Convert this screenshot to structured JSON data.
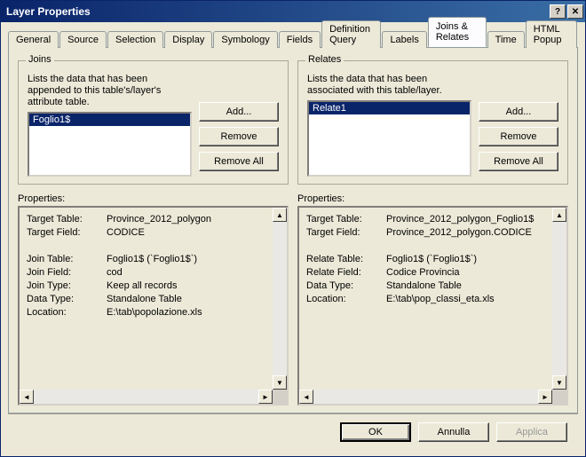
{
  "window": {
    "title": "Layer Properties",
    "help": "?",
    "close": "✕"
  },
  "tabs": [
    "General",
    "Source",
    "Selection",
    "Display",
    "Symbology",
    "Fields",
    "Definition Query",
    "Labels",
    "Joins & Relates",
    "Time",
    "HTML Popup"
  ],
  "active_tab": 8,
  "joins": {
    "legend": "Joins",
    "desc": "Lists the data that has been appended to this table's/layer's attribute table.",
    "items": [
      "Foglio1$"
    ],
    "add": "Add...",
    "remove": "Remove",
    "remove_all": "Remove All"
  },
  "relates": {
    "legend": "Relates",
    "desc": "Lists the data that has been associated with this table/layer.",
    "items": [
      "Relate1"
    ],
    "add": "Add...",
    "remove": "Remove",
    "remove_all": "Remove All"
  },
  "props_label": "Properties:",
  "join_props": [
    {
      "k": "Target Table:",
      "v": "Province_2012_polygon"
    },
    {
      "k": "Target Field:",
      "v": "CODICE"
    },
    {
      "k": "",
      "v": ""
    },
    {
      "k": "Join Table:",
      "v": "Foglio1$ (`Foglio1$`)"
    },
    {
      "k": "Join Field:",
      "v": "cod"
    },
    {
      "k": "Join Type:",
      "v": "Keep all records"
    },
    {
      "k": "Data Type:",
      "v": "Standalone Table"
    },
    {
      "k": "Location:",
      "v": "E:\\tab\\popolazione.xls"
    }
  ],
  "relate_props": [
    {
      "k": "Target Table:",
      "v": "Province_2012_polygon_Foglio1$"
    },
    {
      "k": "Target Field:",
      "v": "Province_2012_polygon.CODICE"
    },
    {
      "k": "",
      "v": ""
    },
    {
      "k": "Relate Table:",
      "v": "Foglio1$ (`Foglio1$`)"
    },
    {
      "k": "Relate Field:",
      "v": "Codice Provincia"
    },
    {
      "k": "Data Type:",
      "v": "Standalone Table"
    },
    {
      "k": "Location:",
      "v": "E:\\tab\\pop_classi_eta.xls"
    }
  ],
  "buttons": {
    "ok": "OK",
    "cancel": "Annulla",
    "apply": "Applica"
  }
}
